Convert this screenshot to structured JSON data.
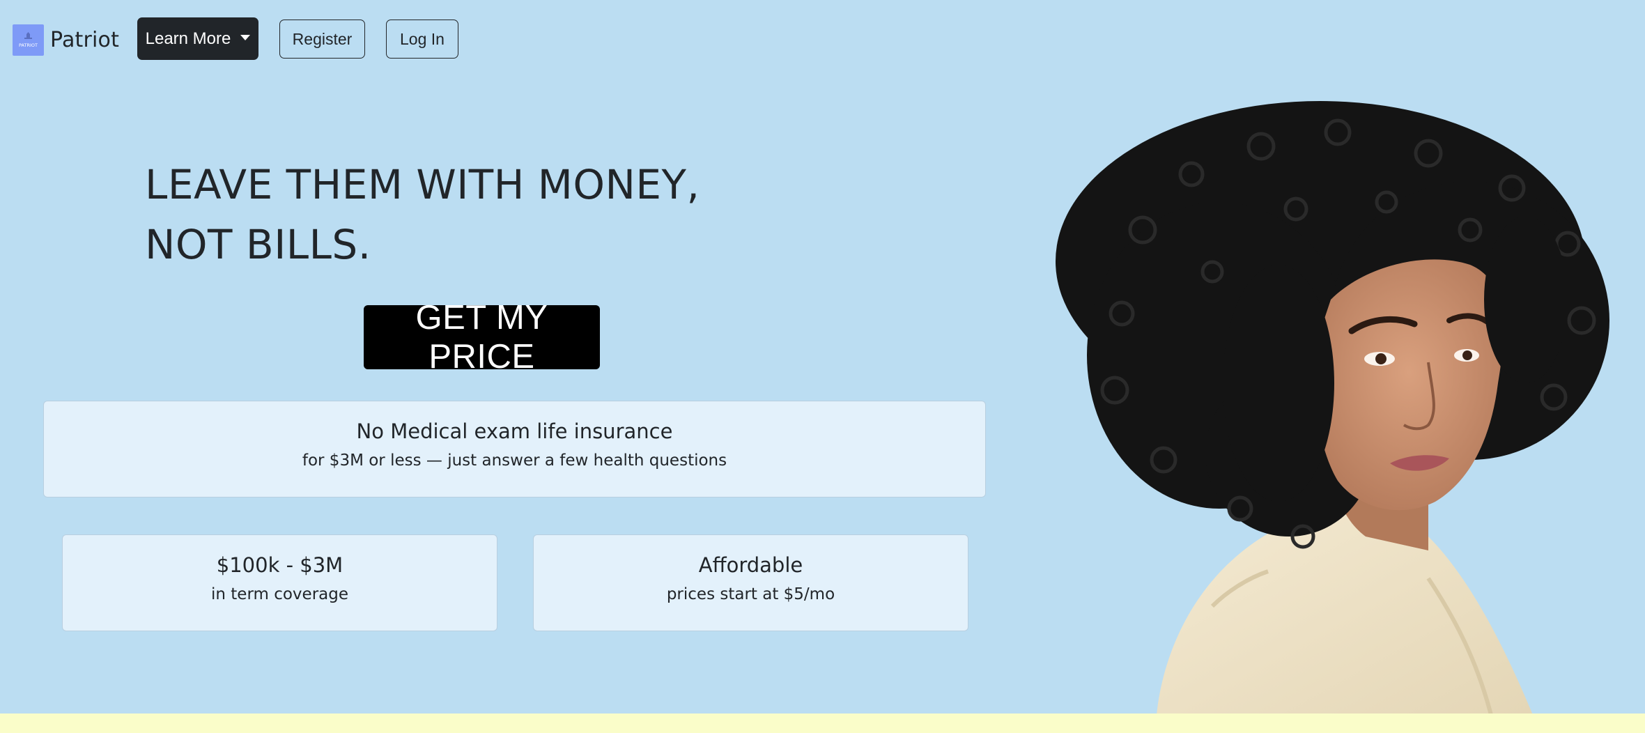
{
  "navbar": {
    "brand_name": "Patriot",
    "logo_text": "PATRIOT",
    "learn_more_label": "Learn More",
    "register_label": "Register",
    "login_label": "Log In"
  },
  "hero": {
    "headline_line1": "LEAVE THEM WITH MONEY,",
    "headline_line2": "NOT BILLS.",
    "cta_label": "GET MY PRICE"
  },
  "cards": {
    "main_title": "No Medical exam life insurance",
    "main_sub": "for $3M or less — just answer a few health questions",
    "coverage_title": "$100k - $3M",
    "coverage_sub": "in term coverage",
    "affordable_title": "Affordable",
    "affordable_sub": "prices start at $5/mo"
  },
  "colors": {
    "background": "#bbddf2",
    "card_bg": "#e3f1fb",
    "dark_button": "#212529",
    "cta_button": "#000000",
    "logo_bg": "#7e9af7",
    "bottom_strip": "#fafdc9"
  },
  "icons": {
    "caret": "chevron-down-icon",
    "logo": "patriot-logo"
  }
}
